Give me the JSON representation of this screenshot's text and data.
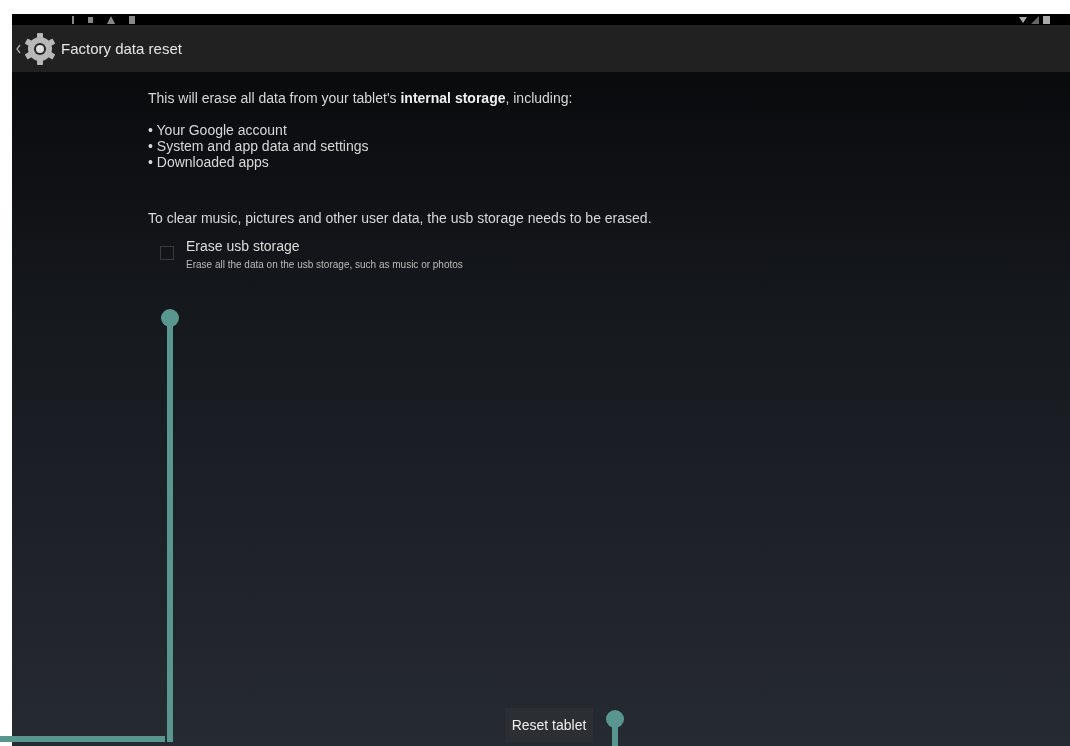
{
  "action_bar": {
    "title": "Factory data reset"
  },
  "intro": "This will erase all data from your tablet's **internal storage**, including:",
  "items": [
    "• Your Google account",
    "• System and app data and settings",
    "• Downloaded apps"
  ],
  "note": "To clear music, pictures and other user data, the usb storage needs to be erased.",
  "option": {
    "label": "Erase usb storage",
    "description": "Erase all the data on the usb storage, such as music or photos",
    "checked": false
  },
  "button": {
    "label": "Reset tablet"
  }
}
